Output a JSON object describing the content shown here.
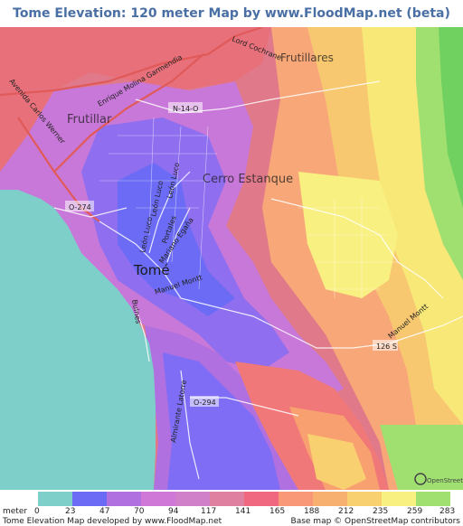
{
  "title": "Tome Elevation: 120 meter Map by www.FloodMap.net (beta)",
  "map": {
    "places": {
      "tome": "Tomé",
      "frutillar": "Frutillar",
      "frutillares": "Frutillares",
      "cerro_estanque": "Cerro Estanque"
    },
    "roads": {
      "lord_cochrane": "Lord Cochrane",
      "enrique_molina": "Enrique Molina Garmendia",
      "avenida_carlos_werner": "Avenida Carlos Werner",
      "n14o": "N-14-O",
      "leon_luco_1": "León Luco",
      "leon_luco_2": "León Luco",
      "leon_luco_3": "León Luco",
      "portales": "Portales",
      "mariano_egana": "Mariano Egaña",
      "o274": "O-274",
      "manuel_montt_1": "Manuel Montt",
      "manuel_montt_2": "Manuel Montt",
      "r126s": "126 S",
      "o294": "O-294",
      "almirante_latorre": "Almirante Latorre",
      "bulnes": "Bulnes"
    },
    "colors": {
      "sea": "#7ecfc9",
      "e0": "#6b6bf5",
      "e23": "#8f6ef0",
      "e47": "#b070e0",
      "e70": "#d078d8",
      "e94": "#d080c8",
      "e117": "#e080a0",
      "e141": "#f08080",
      "e165": "#f89878",
      "e188": "#f8b070",
      "e212": "#f8d070",
      "e235": "#f8f080",
      "e259": "#a0e070",
      "e283": "#70d060"
    },
    "watermark": "OpenStreetMap"
  },
  "legend": {
    "unit": "meter",
    "stops": [
      {
        "value": "0",
        "color": "#7ecfc9"
      },
      {
        "value": "23",
        "color": "#6b6bf5"
      },
      {
        "value": "47",
        "color": "#b070e0"
      },
      {
        "value": "70",
        "color": "#d078d8"
      },
      {
        "value": "94",
        "color": "#d080c8"
      },
      {
        "value": "117",
        "color": "#e080a0"
      },
      {
        "value": "141",
        "color": "#f06880"
      },
      {
        "value": "165",
        "color": "#f89878"
      },
      {
        "value": "188",
        "color": "#f8b070"
      },
      {
        "value": "212",
        "color": "#f8d070"
      },
      {
        "value": "235",
        "color": "#f8f080"
      },
      {
        "value": "259",
        "color": "#a0e070"
      },
      {
        "value": "283",
        "color": "#70d060"
      }
    ]
  },
  "footer": {
    "left": "Tome Elevation Map developed by www.FloodMap.net",
    "right": "Base map © OpenStreetMap contributors"
  }
}
